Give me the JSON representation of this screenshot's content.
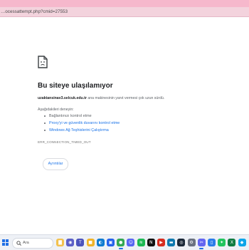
{
  "browser": {
    "url": "…ocessattempt.php?cmid=27553"
  },
  "error_page": {
    "title": "Bu siteye ulaşılamıyor",
    "host": "uzaktansinav3.selcuk.edu.tr",
    "description_rest": " ana makinesinin yanıt vermesi çok uzun sürdü.",
    "try_label": "Aşağıdakileri deneyin:",
    "suggestions": [
      {
        "label": "Bağlantınızı kontrol etme"
      },
      {
        "label": "Proxy'yi ve güvenlik duvarını kontrol etme"
      },
      {
        "label": "Windows Ağ Teşhislerini Çalıştırma"
      }
    ],
    "error_code": "ERR_CONNECTION_TIMED_OUT",
    "reload_label": "Ayrıntılar"
  },
  "taskbar": {
    "search_label": "Ara",
    "icons": [
      {
        "name": "file-explorer-icon",
        "color": "#f2c14e",
        "glyph": "▇"
      },
      {
        "name": "widgets-icon",
        "color": "#5b5fc7",
        "glyph": "◉"
      },
      {
        "name": "teams-icon",
        "color": "#4b53bc",
        "glyph": "T"
      },
      {
        "name": "folder-icon",
        "color": "#f0b429",
        "glyph": "■"
      },
      {
        "name": "edge-icon",
        "color": "#0f7bd0",
        "glyph": "◐"
      },
      {
        "name": "store-icon",
        "color": "#2563eb",
        "glyph": "▣"
      },
      {
        "name": "chrome-icon",
        "color": "#34a853",
        "glyph": "●"
      },
      {
        "name": "discord-icon",
        "color": "#5865f2",
        "glyph": "☺"
      },
      {
        "name": "spotify-icon",
        "color": "#1db954",
        "glyph": "≋"
      },
      {
        "name": "netflix-icon",
        "color": "#111111",
        "glyph": "N"
      },
      {
        "name": "media-icon",
        "color": "#d62d20",
        "glyph": "▶"
      },
      {
        "name": "prime-video-icon",
        "color": "#0f79af",
        "glyph": "▬"
      },
      {
        "name": "steam-icon",
        "color": "#1b2838",
        "glyph": "◎"
      },
      {
        "name": "settings-icon",
        "color": "#6b7280",
        "glyph": "⚙"
      },
      {
        "name": "snipping-icon",
        "color": "#6366f1",
        "glyph": "✂"
      },
      {
        "name": "phone-link-icon",
        "color": "#2b7de9",
        "glyph": "▯"
      },
      {
        "name": "app-green-icon",
        "color": "#22c55e",
        "glyph": "✦"
      },
      {
        "name": "excel-icon",
        "color": "#107c41",
        "glyph": "X"
      },
      {
        "name": "app-last-icon",
        "color": "#0ea5e9",
        "glyph": "◆"
      }
    ]
  }
}
